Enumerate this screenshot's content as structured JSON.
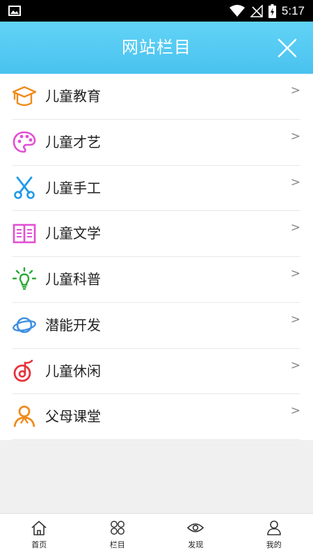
{
  "status_bar": {
    "time": "5:17",
    "icons": [
      "image-icon",
      "wifi-icon",
      "no-signal-icon",
      "battery-charging-icon"
    ]
  },
  "header": {
    "title": "网站栏目",
    "close_icon": "close-icon"
  },
  "menu": {
    "items": [
      {
        "label": "儿童教育",
        "icon": "graduation-cap-icon",
        "color": "#f08a1c",
        "arrow": ">"
      },
      {
        "label": "儿童才艺",
        "icon": "palette-icon",
        "color": "#e14fd3",
        "arrow": ">"
      },
      {
        "label": "儿童手工",
        "icon": "scissors-icon",
        "color": "#1e9bea",
        "arrow": ">"
      },
      {
        "label": "儿童文学",
        "icon": "book-icon",
        "color": "#e14fd3",
        "arrow": ">"
      },
      {
        "label": "儿童科普",
        "icon": "lightbulb-icon",
        "color": "#2aa936",
        "arrow": ">"
      },
      {
        "label": "潜能开发",
        "icon": "planet-icon",
        "color": "#3f8fe0",
        "arrow": ">"
      },
      {
        "label": "儿童休闲",
        "icon": "music-note-icon",
        "color": "#e8323c",
        "arrow": ">"
      },
      {
        "label": "父母课堂",
        "icon": "user-icon",
        "color": "#f08a1c",
        "arrow": ">"
      }
    ]
  },
  "tabbar": {
    "tabs": [
      {
        "label": "首页",
        "icon": "home-icon"
      },
      {
        "label": "栏目",
        "icon": "grid-icon"
      },
      {
        "label": "发现",
        "icon": "eye-icon"
      },
      {
        "label": "我的",
        "icon": "person-icon"
      }
    ]
  }
}
